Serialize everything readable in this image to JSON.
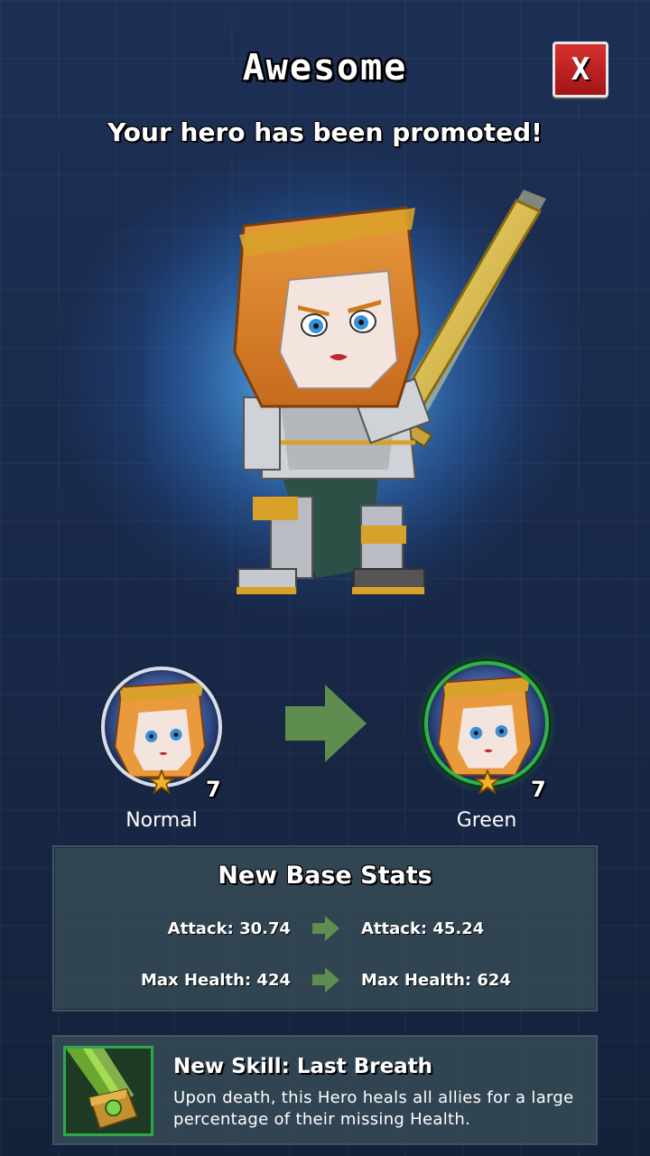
{
  "header": {
    "title": "Awesome",
    "subtitle": "Your hero has been promoted!",
    "close_label": "X"
  },
  "promotion": {
    "from": {
      "rank": "Normal",
      "level": "7",
      "stars": 1
    },
    "to": {
      "rank": "Green",
      "level": "7",
      "stars": 1
    }
  },
  "stats": {
    "title": "New Base Stats",
    "rows": [
      {
        "old": "Attack: 30.74",
        "new": "Attack: 45.24"
      },
      {
        "old": "Max Health: 424",
        "new": "Max Health: 624"
      }
    ]
  },
  "skill": {
    "title": "New Skill: Last Breath",
    "description": "Upon death, this Hero heals all allies for a large percentage of their missing Health."
  },
  "colors": {
    "arrow": "#5e8d4f",
    "close_button": "#c62222",
    "promoted_ring": "#2db34a"
  }
}
